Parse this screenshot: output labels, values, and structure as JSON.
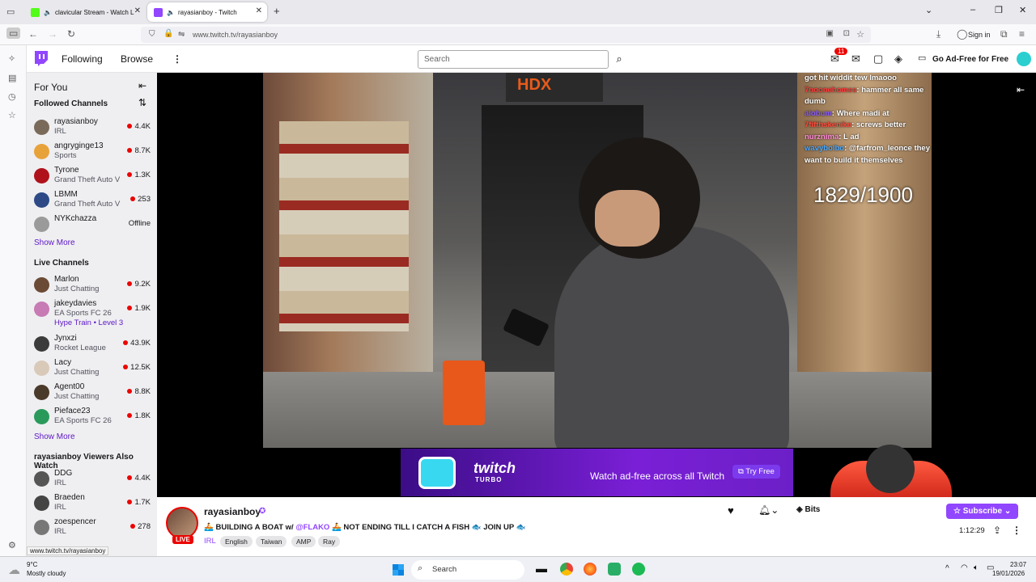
{
  "browser": {
    "tabs": [
      {
        "title": "clavicular Stream - Watch L",
        "active": false
      },
      {
        "title": "rayasianboy - Twitch",
        "active": true
      }
    ],
    "url": "www.twitch.tv/rayasianboy",
    "sign_in": "Sign in",
    "status_url": "www.twitch.tv/rayasianboy"
  },
  "twitch_nav": {
    "following": "Following",
    "browse": "Browse",
    "search_placeholder": "Search",
    "notification_count": "11",
    "go_ad_free": "Go Ad-Free for Free"
  },
  "sidebar": {
    "for_you": "For You",
    "followed_heading": "Followed Channels",
    "followed": [
      {
        "name": "rayasianboy",
        "game": "IRL",
        "viewers": "4.4K",
        "live": true,
        "color": "#7a6a5a"
      },
      {
        "name": "angryginge13",
        "game": "Sports",
        "viewers": "8.7K",
        "live": true,
        "color": "#e8a23a"
      },
      {
        "name": "Tyrone",
        "game": "Grand Theft Auto V",
        "viewers": "1.3K",
        "live": true,
        "color": "#b0121b"
      },
      {
        "name": "LBMM",
        "game": "Grand Theft Auto V",
        "viewers": "253",
        "live": true,
        "color": "#2d4a86"
      },
      {
        "name": "NYKchazza",
        "game": "",
        "viewers": "Offline",
        "live": false,
        "color": "#9a9a9a"
      }
    ],
    "show_more_1": "Show More",
    "live_heading": "Live Channels",
    "live": [
      {
        "name": "Marlon",
        "game": "Just Chatting",
        "viewers": "9.2K",
        "color": "#6b4a36"
      },
      {
        "name": "jakeydavies",
        "game": "EA Sports FC 26",
        "viewers": "1.9K",
        "color": "#c77ab3",
        "extra": "Hype Train • Level 3"
      },
      {
        "name": "Jynxzi",
        "game": "Rocket League",
        "viewers": "43.9K",
        "color": "#3b3b3b"
      },
      {
        "name": "Lacy",
        "game": "Just Chatting",
        "viewers": "12.5K",
        "color": "#d9c9b9"
      },
      {
        "name": "Agent00",
        "game": "Just Chatting",
        "viewers": "8.8K",
        "color": "#4a3a2a"
      },
      {
        "name": "Pieface23",
        "game": "EA Sports FC 26",
        "viewers": "1.8K",
        "color": "#2a9a5a"
      }
    ],
    "show_more_2": "Show More",
    "viewers_heading": "rayasianboy Viewers Also Watch",
    "also": [
      {
        "name": "DDG",
        "game": "IRL",
        "viewers": "4.4K",
        "color": "#555"
      },
      {
        "name": "Braeden",
        "game": "IRL",
        "viewers": "1.7K",
        "color": "#444"
      },
      {
        "name": "zoespencer",
        "game": "IRL",
        "viewers": "278",
        "color": "#777"
      }
    ]
  },
  "player": {
    "chat": [
      {
        "user": "",
        "msg": "got hit widdit tew lmaooo",
        "color": "#ffffff"
      },
      {
        "user": "7noonehomes",
        "msg": "hammer all same dumb",
        "color": "#ff3b3b"
      },
      {
        "user": "alobum",
        "msg": "Where madi at",
        "color": "#8a5cf6"
      },
      {
        "user": "7fifthskenike",
        "msg": "screws better",
        "color": "#ff4a3b"
      },
      {
        "user": "nurznima",
        "msg": "L ad",
        "color": "#ff8ad8"
      },
      {
        "user": "wavybolbo",
        "msg": "@farfrom_leonce they want to build it themselves",
        "color": "#4aa8ff"
      }
    ],
    "goal": "1829/1900",
    "ad_brand": "twitch",
    "ad_sub": "TURBO",
    "ad_text": "Watch ad-free across all Twitch",
    "ad_cta": "Try Free"
  },
  "stream": {
    "channel": "rayasianboy",
    "title": "🚣 BUILDING A BOAT w/ @FLAKO 🚣 NOT ENDING TILL I CATCH A FISH 🐟 JOIN UP 🐟",
    "title_pre": "🚣 BUILDING A BOAT w/ ",
    "title_mention": "@FLAKO",
    "title_post": " 🚣 NOT ENDING TILL I CATCH A FISH 🐟 JOIN UP 🐟",
    "live_badge": "LIVE",
    "category": "IRL",
    "tags": [
      "English",
      "Taiwan",
      "AMP",
      "Ray"
    ],
    "bits_label": "Bits",
    "subscribe": "Subscribe",
    "uptime": "1:12:29"
  },
  "taskbar": {
    "weather_temp": "9°C",
    "weather_desc": "Mostly cloudy",
    "search": "Search",
    "time": "23:07",
    "date": "19/01/2026"
  },
  "colors": {
    "twitch_purple": "#9146ff",
    "live_red": "#eb0400"
  }
}
